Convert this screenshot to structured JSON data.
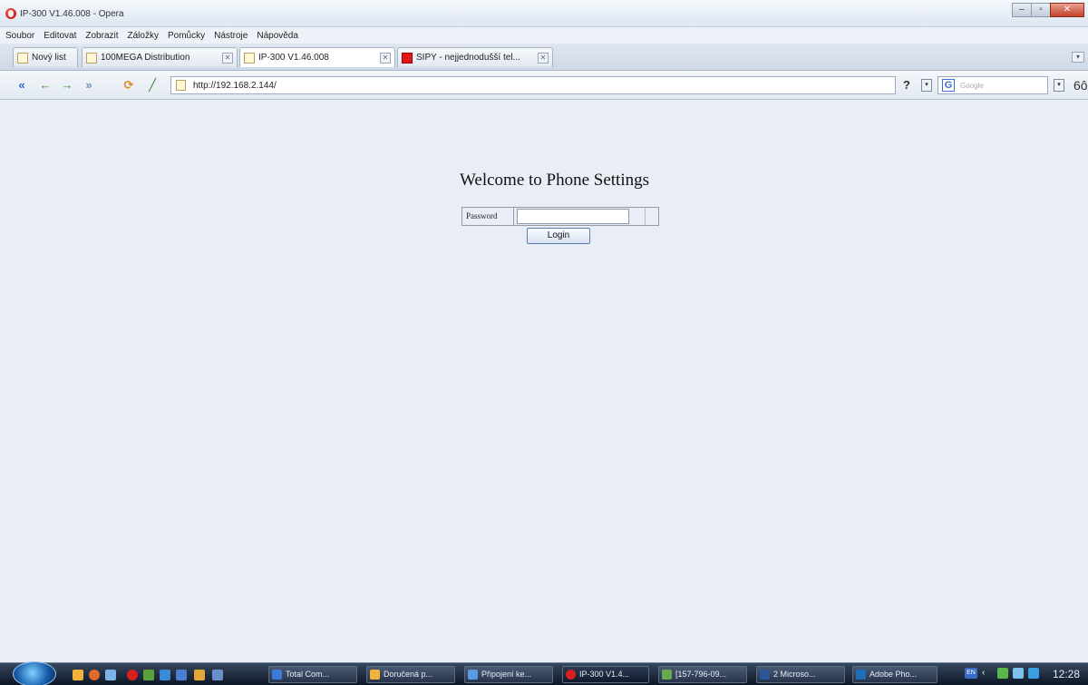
{
  "window": {
    "title": "IP-300 V1.46.008 - Opera"
  },
  "menu": [
    "Soubor",
    "Editovat",
    "Zobrazit",
    "Záložky",
    "Pomůcky",
    "Nástroje",
    "Nápověda"
  ],
  "tabs": [
    {
      "label": "Nový list",
      "icon": "new-page-icon"
    },
    {
      "label": "100MEGA Distribution",
      "icon": "page-icon"
    },
    {
      "label": "IP-300 V1.46.008",
      "icon": "page-icon"
    },
    {
      "label": "SIPY - nejjednodušší tel...",
      "icon": "sipy-favicon"
    }
  ],
  "address": {
    "url": "http://192.168.2.144/",
    "help": "?"
  },
  "search": {
    "placeholder": "Google"
  },
  "zoom_glyph": "6ô",
  "page": {
    "heading": "Welcome to Phone Settings",
    "password_label": "Password",
    "password_value": "",
    "login_label": "Login"
  },
  "taskbar": {
    "items": [
      {
        "label": "Total Com..."
      },
      {
        "label": "Doručená p..."
      },
      {
        "label": "Připojení ke..."
      },
      {
        "label": "IP-300 V1.4..."
      },
      {
        "label": "[157-796-09..."
      },
      {
        "label": "2 Microso..."
      },
      {
        "label": "Adobe Pho..."
      }
    ],
    "lang": "EN",
    "clock": "12:28"
  }
}
